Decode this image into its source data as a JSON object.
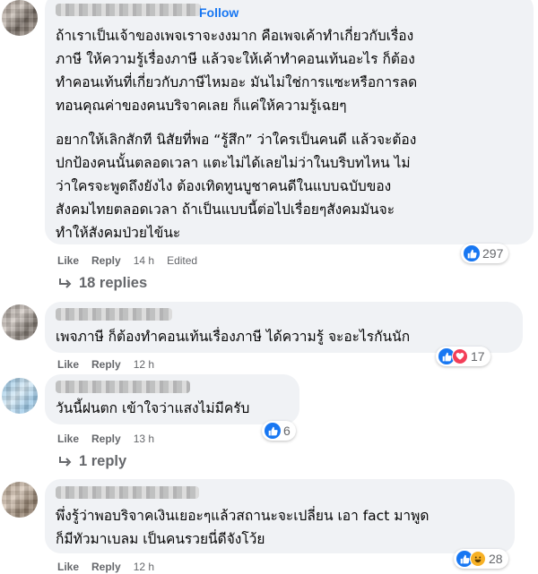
{
  "comments": [
    {
      "follow_label": "Follow",
      "paragraphs": [
        "ถ้าเราเป็นเจ้าของเพจเราจะงงมาก คือเพจเค้าทำเกี่ยวกับเรื่อง\nภาษี ให้ความรู้เรื่องภาษี แล้วจะให้เค้าทำคอนเท้นอะไร ก็ต้อง\nทำคอนเท้นที่เกี่ยวกับภาษีไหมอะ มันไม่ใช่การแซะหรือการลด\nทอนคุณค่าของคนบริจาคเลย ก็แค่ให้ความรู้เฉยๆ",
        "อยากให้เลิกสักที นิสัยที่พอ “รู้สึก” ว่าใครเป็นคนดี แล้วจะต้อง\nปกป้องคนนั้นตลอดเวลา แตะไม่ได้เลยไม่ว่าในบริบทไหน ไม่\nว่าใครจะพูดถึงยังไง ต้องเทิดทูนบูชาคนดีในแบบฉบับของ\nสังคมไทยตลอดเวลา ถ้าเป็นแบบนี้ต่อไปเรื่อยๆสังคมมันจะ\nทำให้สังคมป่วยไข้นะ"
      ],
      "like_label": "Like",
      "reply_label": "Reply",
      "time": "14 h",
      "edited": "Edited",
      "reaction_count": "297",
      "replies_label": "18 replies"
    },
    {
      "text": "เพจภาษี ก็ต้องทำคอนเท้นเรื่องภาษี ได้ความรู้ จะอะไรกันนัก",
      "like_label": "Like",
      "reply_label": "Reply",
      "time": "12 h",
      "reaction_count": "17"
    },
    {
      "text": "วันนี้ฝนตก เข้าใจว่าแสงไม่มีครับ",
      "like_label": "Like",
      "reply_label": "Reply",
      "time": "13 h",
      "reaction_count": "6",
      "replies_label": "1 reply"
    },
    {
      "text": "พึ่งรู้ว่าพอบริจาคเงินเยอะๆแล้วสถานะจะเปลี่ยน เอา fact มาพูด\nก็มีทัวมาเบลม เป็นคนรวยนี่ดีจังโว้ย",
      "like_label": "Like",
      "reply_label": "Reply",
      "time": "12 h",
      "reaction_count": "28"
    }
  ],
  "colors": {
    "accent": "#1877f2",
    "bubble": "#f0f2f5",
    "meta": "#65676b",
    "love": "#f33e58",
    "haha": "#f7b125"
  },
  "icons": [
    "like-reaction-icon",
    "love-reaction-icon",
    "haha-reaction-icon",
    "reply-arrow-icon"
  ]
}
